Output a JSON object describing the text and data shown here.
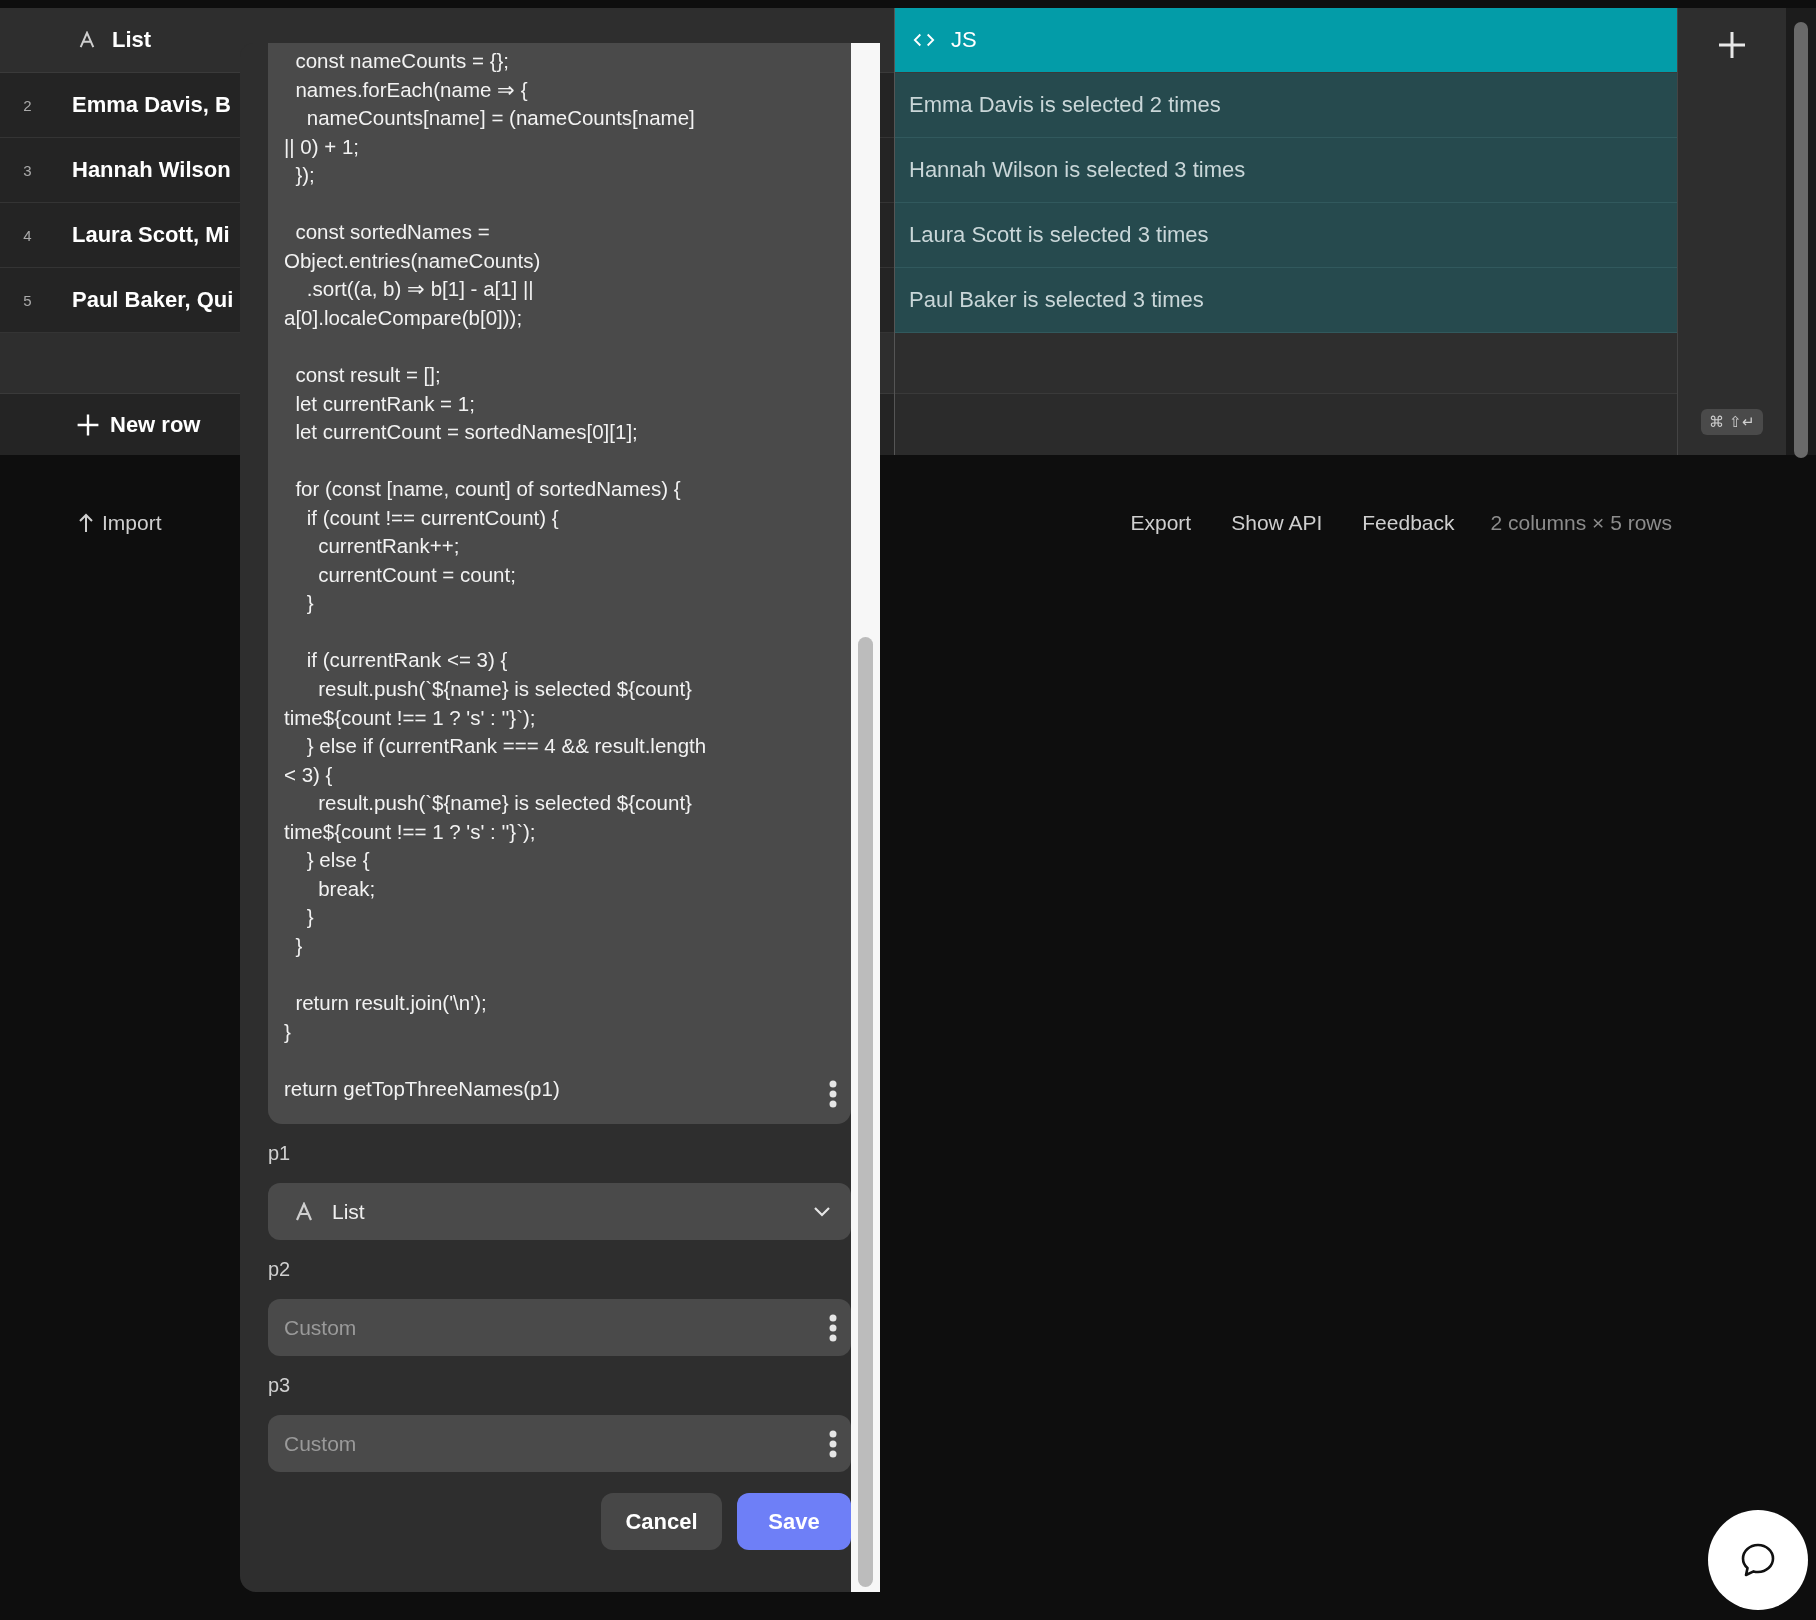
{
  "table": {
    "columns": [
      {
        "kind": "text",
        "title": "List",
        "selected": false
      },
      {
        "kind": "code",
        "title": "JS",
        "selected": true
      }
    ],
    "rows": [
      {
        "number": "2",
        "cells": [
          "Emma Davis, B",
          "Emma Davis is selected 2 times"
        ]
      },
      {
        "number": "3",
        "cells": [
          "Hannah Wilson",
          "Hannah Wilson is selected 3 times"
        ]
      },
      {
        "number": "4",
        "cells": [
          "Laura Scott, Mi",
          "Laura Scott is selected 3 times"
        ]
      },
      {
        "number": "5",
        "cells": [
          "Paul Baker, Qui",
          "Paul Baker is selected 3 times"
        ]
      }
    ],
    "new_row": "New row",
    "shortcut": "⌘ ⇧↵"
  },
  "footer": {
    "import": "Import",
    "links": [
      "Export",
      "Show API",
      "Feedback"
    ],
    "summary": "2 columns × 5 rows"
  },
  "dialog": {
    "code": "  const nameCounts = {};\n  names.forEach(name ⇒ {\n    nameCounts[name] = (nameCounts[name]\n|| 0) + 1;\n  });\n\n  const sortedNames =\nObject.entries(nameCounts)\n    .sort((a, b) ⇒ b[1] - a[1] ||\na[0].localeCompare(b[0]));\n\n  const result = [];\n  let currentRank = 1;\n  let currentCount = sortedNames[0][1];\n\n  for (const [name, count] of sortedNames) {\n    if (count !== currentCount) {\n      currentRank++;\n      currentCount = count;\n    }\n\n    if (currentRank <= 3) {\n      result.push(`${name} is selected ${count}\ntime${count !== 1 ? 's' : ''}`);\n    } else if (currentRank === 4 && result.length\n< 3) {\n      result.push(`${name} is selected ${count}\ntime${count !== 1 ? 's' : ''}`);\n    } else {\n      break;\n    }\n  }\n\n  return result.join('\\n');\n}\n\nreturn getTopThreeNames(p1)",
    "params": [
      {
        "label": "p1",
        "kind": "select",
        "value": "List"
      },
      {
        "label": "p2",
        "kind": "custom",
        "placeholder": "Custom"
      },
      {
        "label": "p3",
        "kind": "custom",
        "placeholder": "Custom"
      }
    ],
    "buttons": [
      {
        "label": "Cancel",
        "kind": "secondary"
      },
      {
        "label": "Save",
        "kind": "primary"
      }
    ]
  }
}
